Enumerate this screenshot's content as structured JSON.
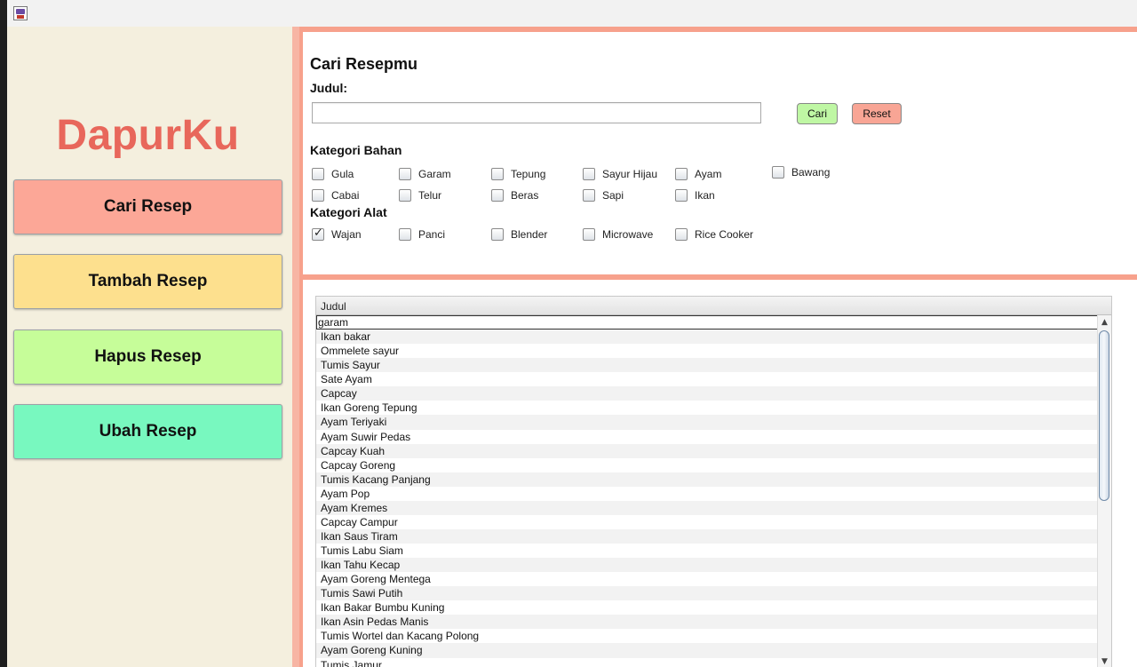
{
  "app": {
    "logo": "DapurKu",
    "icon": "java-coffee-icon"
  },
  "sidebar": {
    "items": [
      {
        "label": "Cari Resep",
        "color": "#fca797"
      },
      {
        "label": "Tambah Resep",
        "color": "#fde08e"
      },
      {
        "label": "Hapus Resep",
        "color": "#c6fd99"
      },
      {
        "label": "Ubah Resep",
        "color": "#78f8bf"
      }
    ]
  },
  "search": {
    "heading": "Cari Resepmu",
    "title_label": "Judul:",
    "title_value": "",
    "search_button": "Cari",
    "reset_button": "Reset",
    "ingredients_label": "Kategori Bahan",
    "ingredients": [
      {
        "label": "Gula",
        "checked": false
      },
      {
        "label": "Garam",
        "checked": false
      },
      {
        "label": "Tepung",
        "checked": false
      },
      {
        "label": "Sayur Hijau",
        "checked": false
      },
      {
        "label": "Ayam",
        "checked": false
      },
      {
        "label": "Bawang",
        "checked": false
      },
      {
        "label": "Cabai",
        "checked": false
      },
      {
        "label": "Telur",
        "checked": false
      },
      {
        "label": "Beras",
        "checked": false
      },
      {
        "label": "Sapi",
        "checked": false
      },
      {
        "label": "Ikan",
        "checked": false
      }
    ],
    "tools_label": "Kategori Alat",
    "tools": [
      {
        "label": "Wajan",
        "checked": true
      },
      {
        "label": "Panci",
        "checked": false
      },
      {
        "label": "Blender",
        "checked": false
      },
      {
        "label": "Microwave",
        "checked": false
      },
      {
        "label": "Rice Cooker",
        "checked": false
      }
    ]
  },
  "results": {
    "column_header": "Judul",
    "rows": [
      "garam",
      "Ikan bakar",
      "Ommelete sayur",
      "Tumis Sayur",
      "Sate Ayam",
      "Capcay",
      "Ikan Goreng Tepung",
      "Ayam Teriyaki",
      "Ayam Suwir Pedas",
      "Capcay Kuah",
      "Capcay Goreng",
      "Tumis Kacang Panjang",
      "Ayam Pop",
      "Ayam Kremes",
      "Capcay Campur",
      "Ikan Saus Tiram",
      "Tumis Labu Siam",
      "Ikan Tahu Kecap",
      "Ayam Goreng Mentega",
      "Tumis Sawi Putih",
      "Ikan Bakar Bumbu Kuning",
      "Ikan Asin Pedas Manis",
      "Tumis Wortel dan Kacang Polong",
      "Ayam Goreng Kuning",
      "Tumis Jamur"
    ]
  }
}
